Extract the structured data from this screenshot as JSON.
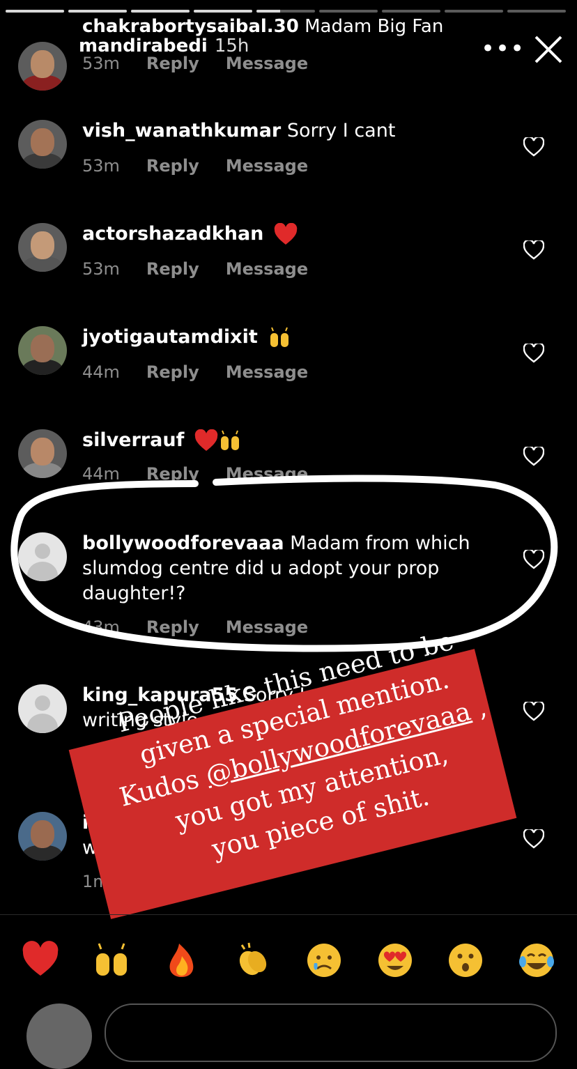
{
  "story": {
    "progress_fill": [
      1,
      1,
      1,
      1,
      0.4,
      0,
      0,
      0,
      0
    ],
    "user": "mandirabedi",
    "time": "15h"
  },
  "comments": [
    {
      "user": "chakrabortysaibal.30",
      "text": "Madam Big Fan",
      "time": "53m",
      "reply": "Reply",
      "message": "Message"
    },
    {
      "user": "vish_wanathkumar",
      "text": "Sorry I cant",
      "time": "53m",
      "reply": "Reply",
      "message": "Message"
    },
    {
      "user": "actorshazadkhan",
      "text": "",
      "time": "53m",
      "reply": "Reply",
      "message": "Message",
      "emojis": [
        "red-heart"
      ]
    },
    {
      "user": "jyotigautamdixit",
      "text": "",
      "time": "44m",
      "reply": "Reply",
      "message": "Message",
      "emojis": [
        "raising-hands"
      ]
    },
    {
      "user": "silverrauf",
      "text": "",
      "time": "44m",
      "reply": "Reply",
      "message": "Message",
      "emojis": [
        "red-heart",
        "raising-hands"
      ]
    },
    {
      "user": "bollywoodforevaaa",
      "text": "Madam from which slumdog centre did u adopt your prop daughter!?",
      "time": "43m",
      "reply": "Reply",
      "message": "Message"
    },
    {
      "user": "king_kapura55",
      "text": "Sorry I",
      "text2": "writing style",
      "time": "",
      "reply": "",
      "message": ""
    },
    {
      "user": "ia",
      "text": "",
      "text2": "wi",
      "time": "1m",
      "reply": "",
      "message": ""
    }
  ],
  "overlay": {
    "lines": [
      "People like this need to be",
      "given a special mention.",
      "Kudos",
      "@bollywoodforevaaa",
      ",",
      "you got my attention,",
      "you piece of shit."
    ]
  },
  "quick_reactions": [
    "red-heart-icon",
    "raising-hands-icon",
    "fire-icon",
    "clapping-hands-icon",
    "crying-face-icon",
    "heart-eyes-icon",
    "surprised-face-icon",
    "tears-of-joy-icon"
  ],
  "colors": {
    "background": "#000000",
    "meta_text": "#8e8e8e",
    "overlay_red": "#cf2c2a"
  }
}
